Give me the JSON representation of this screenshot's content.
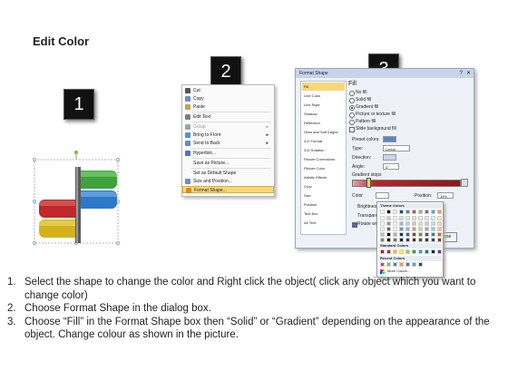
{
  "page": {
    "title": "Edit Color"
  },
  "step_badges": [
    "1",
    "2",
    "3"
  ],
  "context_menu": {
    "items": [
      {
        "label": "Cut",
        "icon": "scissors-icon",
        "color": "#555555"
      },
      {
        "label": "Copy",
        "icon": "copy-icon",
        "color": "#6b8fc7"
      },
      {
        "label": "Paste",
        "icon": "paste-icon",
        "color": "#c9a14a"
      },
      {
        "label": "Edit Text",
        "icon": "edit-text-icon",
        "color": "#7f7f7f"
      },
      {
        "label": "Group",
        "icon": "group-icon",
        "color": "#9aa4b5",
        "submenu": true
      },
      {
        "label": "Bring to Front",
        "icon": "bring-front-icon",
        "color": "#5a8fd1",
        "submenu": true
      },
      {
        "label": "Send to Back",
        "icon": "send-back-icon",
        "color": "#5a8fd1",
        "submenu": true
      },
      {
        "label": "Hyperlink...",
        "icon": "hyperlink-icon",
        "color": "#4a77b9"
      },
      {
        "label": "Save as Picture...",
        "icon": "",
        "color": ""
      },
      {
        "label": "Set as Default Shape",
        "icon": "",
        "color": ""
      },
      {
        "label": "Size and Position...",
        "icon": "size-icon",
        "color": "#6b8fc7"
      },
      {
        "label": "Format Shape...",
        "icon": "format-shape-icon",
        "color": "#d68b2a",
        "highlighted": true
      }
    ]
  },
  "dialog": {
    "title": "Format Shape",
    "sidebar": [
      "Fill",
      "Line Color",
      "Line Style",
      "Shadow",
      "Reflection",
      "Glow and Soft Edges",
      "3-D Format",
      "3-D Rotation",
      "Picture Corrections",
      "Picture Color",
      "Artistic Effects",
      "Crop",
      "Size",
      "Position",
      "Text Box",
      "Alt Text"
    ],
    "heading": "Fill",
    "fill_options": [
      {
        "label": "No fill",
        "selected": false
      },
      {
        "label": "Solid fill",
        "selected": false
      },
      {
        "label": "Gradient fill",
        "selected": true
      },
      {
        "label": "Picture or texture fill",
        "selected": false
      },
      {
        "label": "Pattern fill",
        "selected": false
      }
    ],
    "slide_background": "Slide background fill",
    "preset_colors": "Preset colors:",
    "type": {
      "label": "Type:",
      "value": "Linear"
    },
    "direction": "Direction:",
    "angle": {
      "label": "Angle:",
      "value": "0°"
    },
    "gradient_stops": "Gradient stops",
    "color_label": "Color",
    "position": {
      "label": "Position:",
      "value": "15%"
    },
    "brightness": "Brightness:",
    "transparency": "Transparency:",
    "rotate_with_shape": "Rotate with shape",
    "close": "Close"
  },
  "palette": {
    "theme_header": "Theme Colors",
    "standard_header": "Standard Colors",
    "recent_header": "Recent Colors",
    "more": "More Colors...",
    "theme_top": [
      "#ffffff",
      "#000000",
      "#eeece1",
      "#1f497d",
      "#4f81bd",
      "#c0504d",
      "#9bbb59",
      "#8064a2",
      "#4bacc6",
      "#f79646"
    ],
    "standard": [
      "#c00000",
      "#ff0000",
      "#ffc000",
      "#ffff00",
      "#92d050",
      "#00b050",
      "#00b0f0",
      "#0070c0",
      "#002060",
      "#7030a0"
    ],
    "recent": [
      "#c0504d",
      "#9bbb59",
      "#4f81bd",
      "#f79646",
      "#8064a2",
      "#4bacc6",
      "#1f497d"
    ]
  },
  "instructions": [
    {
      "num": "1.",
      "text": "Select the shape to change the color and Right click the object( click any object which you want to change color)"
    },
    {
      "num": "2.",
      "text": "Choose Format Shape in the dialog box."
    },
    {
      "num": "3.",
      "text": "Choose “Fill” in the Format Shape box then “Solid” or “Gradient” depending on the appearance of the object. Change colour as shown in the picture."
    }
  ],
  "colors": {
    "shape_red": "#c0282a",
    "shape_yellow": "#d4b21c",
    "shape_green": "#3fa23a",
    "shape_blue": "#2e78c8",
    "menu_highlight": "#f7d77a"
  }
}
